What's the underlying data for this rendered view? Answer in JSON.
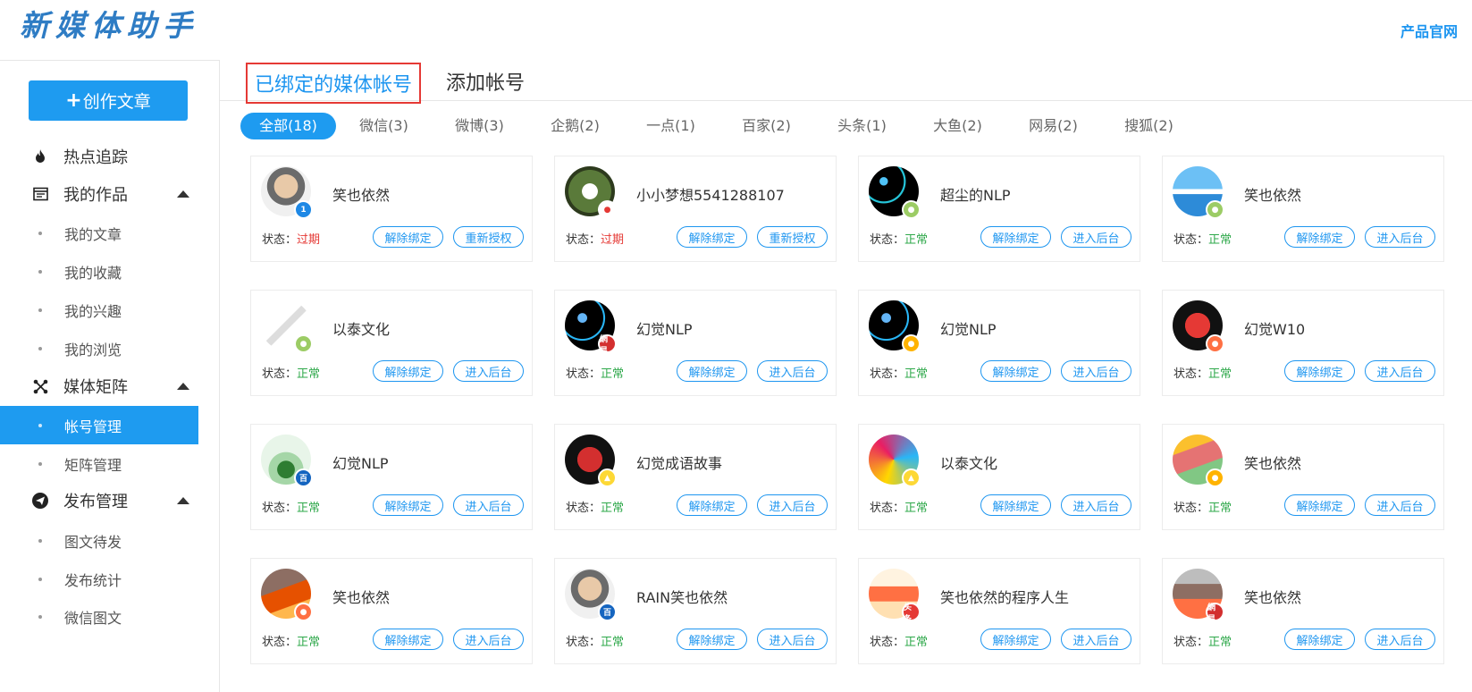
{
  "header": {
    "logo": "新媒体助手",
    "official_site": "产品官网"
  },
  "sidebar": {
    "create_button": "创作文章",
    "sections": [
      {
        "label": "热点追踪",
        "icon": "flame-icon",
        "children": []
      },
      {
        "label": "我的作品",
        "icon": "calendar-icon",
        "children": [
          "我的文章",
          "我的收藏",
          "我的兴趣",
          "我的浏览"
        ]
      },
      {
        "label": "媒体矩阵",
        "icon": "network-icon",
        "children": [
          "帐号管理",
          "矩阵管理"
        ]
      },
      {
        "label": "发布管理",
        "icon": "send-icon",
        "children": [
          "图文待发",
          "发布统计",
          "微信图文"
        ]
      }
    ],
    "active_item": "帐号管理"
  },
  "tabs": {
    "bound": "已绑定的媒体帐号",
    "add": "添加帐号"
  },
  "filters": [
    "全部(18)",
    "微信(3)",
    "微博(3)",
    "企鹅(2)",
    "一点(1)",
    "百家(2)",
    "头条(1)",
    "大鱼(2)",
    "网易(2)",
    "搜狐(2)"
  ],
  "labels": {
    "status_prefix": "状态：",
    "unbind": "解除绑定"
  },
  "colors": {
    "accent": "#1e9bf0",
    "ok": "#2ea84a",
    "expired": "#e53935"
  },
  "accounts": [
    {
      "name": "笑也依然",
      "status": "过期",
      "action": "重新授权",
      "platform": "yidian-icon"
    },
    {
      "name": "小小梦想5541288107",
      "status": "过期",
      "action": "重新授权",
      "platform": "weibo-icon"
    },
    {
      "name": "超尘的NLP",
      "status": "正常",
      "action": "进入后台",
      "platform": "wechat-icon"
    },
    {
      "name": "笑也依然",
      "status": "正常",
      "action": "进入后台",
      "platform": "wechat-icon"
    },
    {
      "name": "以泰文化",
      "status": "正常",
      "action": "进入后台",
      "platform": "wechat-icon"
    },
    {
      "name": "幻觉NLP",
      "status": "正常",
      "action": "进入后台",
      "platform": "netease-icon",
      "badge_text": "網易"
    },
    {
      "name": "幻觉NLP",
      "status": "正常",
      "action": "进入后台",
      "platform": "sohu-icon"
    },
    {
      "name": "幻觉W10",
      "status": "正常",
      "action": "进入后台",
      "platform": "dayu-icon"
    },
    {
      "name": "幻觉NLP",
      "status": "正常",
      "action": "进入后台",
      "platform": "baijia-icon",
      "badge_text": "百"
    },
    {
      "name": "幻觉成语故事",
      "status": "正常",
      "action": "进入后台",
      "platform": "penguin-icon"
    },
    {
      "name": "以泰文化",
      "status": "正常",
      "action": "进入后台",
      "platform": "penguin-icon"
    },
    {
      "name": "笑也依然",
      "status": "正常",
      "action": "进入后台",
      "platform": "sohu-icon"
    },
    {
      "name": "笑也依然",
      "status": "正常",
      "action": "进入后台",
      "platform": "dayu-icon"
    },
    {
      "name": "RAIN笑也依然",
      "status": "正常",
      "action": "进入后台",
      "platform": "baijia-icon",
      "badge_text": "百"
    },
    {
      "name": "笑也依然的程序人生",
      "status": "正常",
      "action": "进入后台",
      "platform": "toutiao-icon",
      "badge_text": "头条"
    },
    {
      "name": "笑也依然",
      "status": "正常",
      "action": "进入后台",
      "platform": "netease-icon",
      "badge_text": "網易"
    }
  ]
}
